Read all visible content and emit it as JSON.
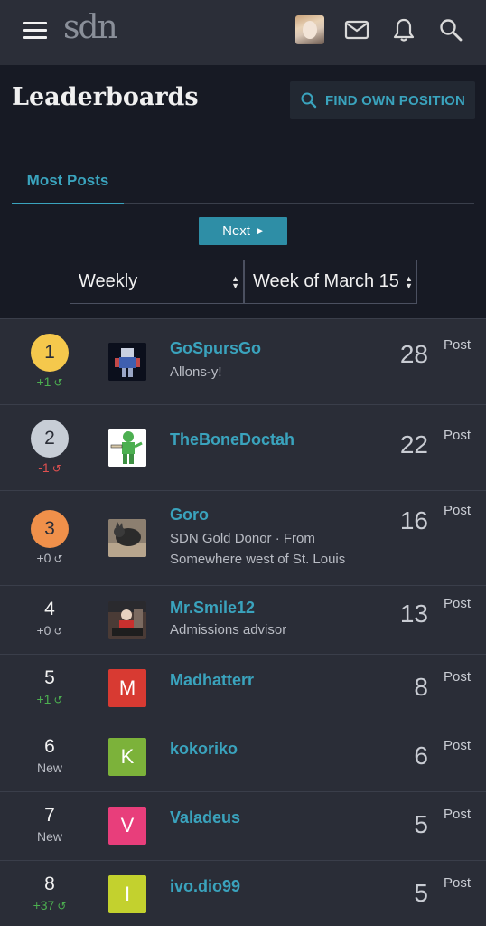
{
  "header": {
    "logo_text": "sdn",
    "page_title": "Leaderboards",
    "find_position_label": "FIND OWN POSITION"
  },
  "tabs": [
    {
      "label": "Most Posts",
      "active": true
    }
  ],
  "pagination": {
    "next_label": "Next"
  },
  "filters": {
    "period": "Weekly",
    "week": "Week of March 15"
  },
  "colors": {
    "accent": "#3aa3bd",
    "gold": "#f5c84c",
    "silver": "#c7cdd6",
    "bronze": "#f0904a",
    "up": "#4caf50",
    "down": "#e05050"
  },
  "leaderboard": [
    {
      "rank": "1",
      "change": "+1",
      "username": "GoSpursGo",
      "subtitle": "Allons-y!",
      "count": "28",
      "unit": "Post"
    },
    {
      "rank": "2",
      "change": "-1",
      "username": "TheBoneDoctah",
      "subtitle": "",
      "count": "22",
      "unit": "Post"
    },
    {
      "rank": "3",
      "change": "+0",
      "username": "Goro",
      "subtitle": "SDN Gold Donor · From Somewhere west of St. Louis",
      "count": "16",
      "unit": "Post"
    },
    {
      "rank": "4",
      "change": "+0",
      "username": "Mr.Smile12",
      "subtitle": "Admissions advisor",
      "count": "13",
      "unit": "Post"
    },
    {
      "rank": "5",
      "change": "+1",
      "username": "Madhatterr",
      "subtitle": "",
      "count": "8",
      "unit": "Post",
      "avatar_letter": "M"
    },
    {
      "rank": "6",
      "change": "New",
      "username": "kokoriko",
      "subtitle": "",
      "count": "6",
      "unit": "Post",
      "avatar_letter": "K"
    },
    {
      "rank": "7",
      "change": "New",
      "username": "Valadeus",
      "subtitle": "",
      "count": "5",
      "unit": "Post",
      "avatar_letter": "V"
    },
    {
      "rank": "8",
      "change": "+37",
      "username": "ivo.dio99",
      "subtitle": "",
      "count": "5",
      "unit": "Post",
      "avatar_letter": "I"
    }
  ]
}
